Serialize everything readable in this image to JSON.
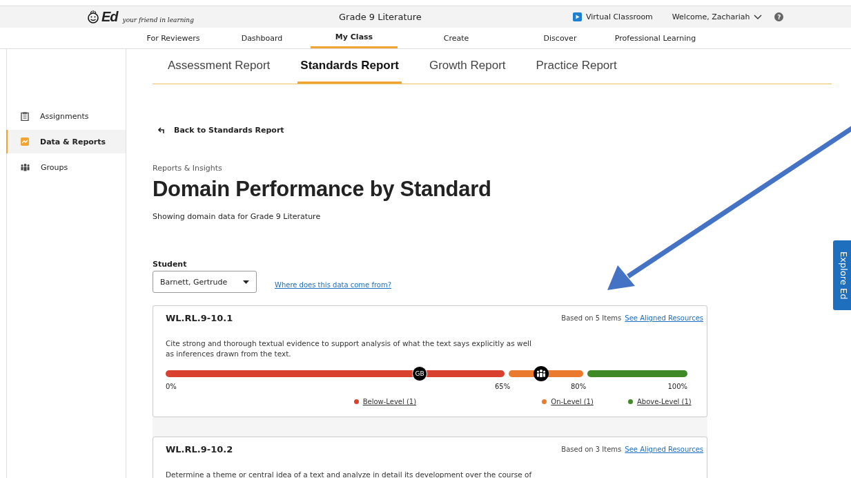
{
  "header": {
    "logo": "Ed",
    "tagline": "your friend in learning",
    "title": "Grade 9 Literature",
    "virtual_classroom": "Virtual Classroom",
    "welcome": "Welcome, Zachariah",
    "help": "?"
  },
  "nav": [
    {
      "label": "For Reviewers",
      "selected": false
    },
    {
      "label": "Dashboard",
      "selected": false
    },
    {
      "label": "My Class",
      "selected": true
    },
    {
      "label": "Create",
      "selected": false
    },
    {
      "label": "Discover",
      "selected": false
    },
    {
      "label": "Professional Learning",
      "selected": false
    }
  ],
  "sidebar": {
    "items": [
      {
        "label": "Assignments",
        "kind": "clipboard",
        "selected": false
      },
      {
        "label": "Data & Reports",
        "kind": "chart",
        "selected": true
      },
      {
        "label": "Groups",
        "kind": "people",
        "selected": false
      }
    ]
  },
  "report_tabs": [
    {
      "label": "Assessment Report",
      "selected": false
    },
    {
      "label": "Standards Report",
      "selected": true
    },
    {
      "label": "Growth Report",
      "selected": false
    },
    {
      "label": "Practice Report",
      "selected": false
    }
  ],
  "back_link": "Back to Standards Report",
  "eyebrow": "Reports & Insights",
  "heading": "Domain Performance by Standard",
  "subheading": "Showing domain data for Grade 9 Literature",
  "student": {
    "label": "Student",
    "value": "Barnett, Gertrude"
  },
  "data_source_link": "Where does this data come from?",
  "standards": [
    {
      "code": "WL.RL.9-10.1",
      "items": "Based on 5 Items",
      "resources_link": "See Aligned Resources",
      "description": "Cite strong and thorough textual evidence to support analysis of what the text says explicitly as well as inferences drawn from the text.",
      "bands": [
        {
          "color": "#d9412f"
        },
        {
          "color": "#ea7a2e"
        },
        {
          "color": "#3f8a26"
        }
      ],
      "markers": [
        {
          "kind": "initials",
          "label": "GB",
          "level": 0.487
        },
        {
          "kind": "group",
          "level": 0.72
        }
      ],
      "ticks": [
        "0%",
        "65%",
        "80%",
        "100%"
      ],
      "legend": [
        {
          "label": "Below-Level (1)",
          "color": "#d9412f"
        },
        {
          "label": "On-Level (1)",
          "color": "#ea7a2e"
        },
        {
          "label": "Above-Level (1)",
          "color": "#3f8a26"
        }
      ]
    },
    {
      "code": "WL.RL.9-10.2",
      "items": "Based on 3 Items",
      "resources_link": "See Aligned Resources",
      "description": "Determine a theme or central idea of a text and analyze in detail its development over the course of"
    }
  ],
  "explore_tab": "Explore Ed"
}
